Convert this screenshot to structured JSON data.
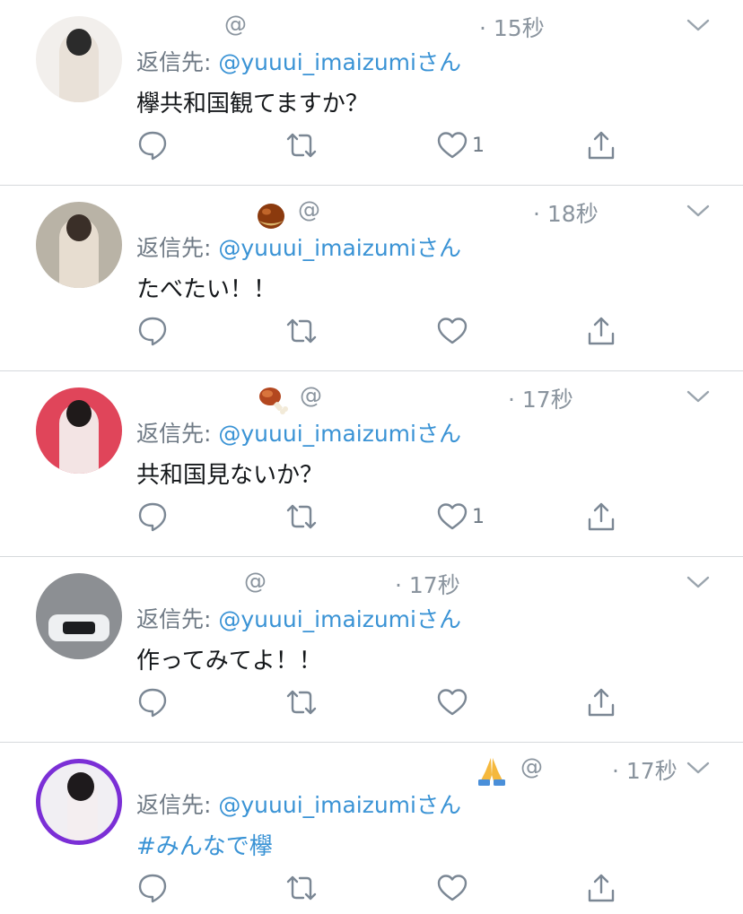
{
  "colors": {
    "link": "#3a93d5",
    "meta": "#8a949e",
    "divider": "#d6d9dc",
    "ring": "#7b2fd6"
  },
  "tweets": [
    {
      "at": "@",
      "time": "· 15秒",
      "emoji": "",
      "reply_prefix": "返信先: ",
      "reply_handle": "@yuuui_imaizumi",
      "reply_suffix": "さん",
      "text": "欅共和国観てますか？",
      "like_count": "1"
    },
    {
      "at": "@",
      "time": "· 18秒",
      "emoji": "chestnut-emoji",
      "reply_prefix": "返信先: ",
      "reply_handle": "@yuuui_imaizumi",
      "reply_suffix": "さん",
      "text": "たべたい！！",
      "like_count": ""
    },
    {
      "at": "@",
      "time": "· 17秒",
      "emoji": "meat-on-bone-emoji",
      "reply_prefix": "返信先: ",
      "reply_handle": "@yuuui_imaizumi",
      "reply_suffix": "さん",
      "text": "共和国見ないか？",
      "like_count": "1"
    },
    {
      "at": "@",
      "time": "· 17秒",
      "emoji": "",
      "reply_prefix": "返信先: ",
      "reply_handle": "@yuuui_imaizumi",
      "reply_suffix": "さん",
      "text": "作ってみてよ！！",
      "like_count": ""
    },
    {
      "at": "@",
      "time": "· 17秒",
      "emoji": "folded-hands-emoji",
      "reply_prefix": "返信先: ",
      "reply_handle": "@yuuui_imaizumi",
      "reply_suffix": "さん",
      "text": "#みんなで欅",
      "like_count": ""
    }
  ],
  "icons": {
    "reply": "reply-icon",
    "retweet": "retweet-icon",
    "like": "heart-icon",
    "share": "share-icon",
    "more": "chevron-down-icon"
  }
}
